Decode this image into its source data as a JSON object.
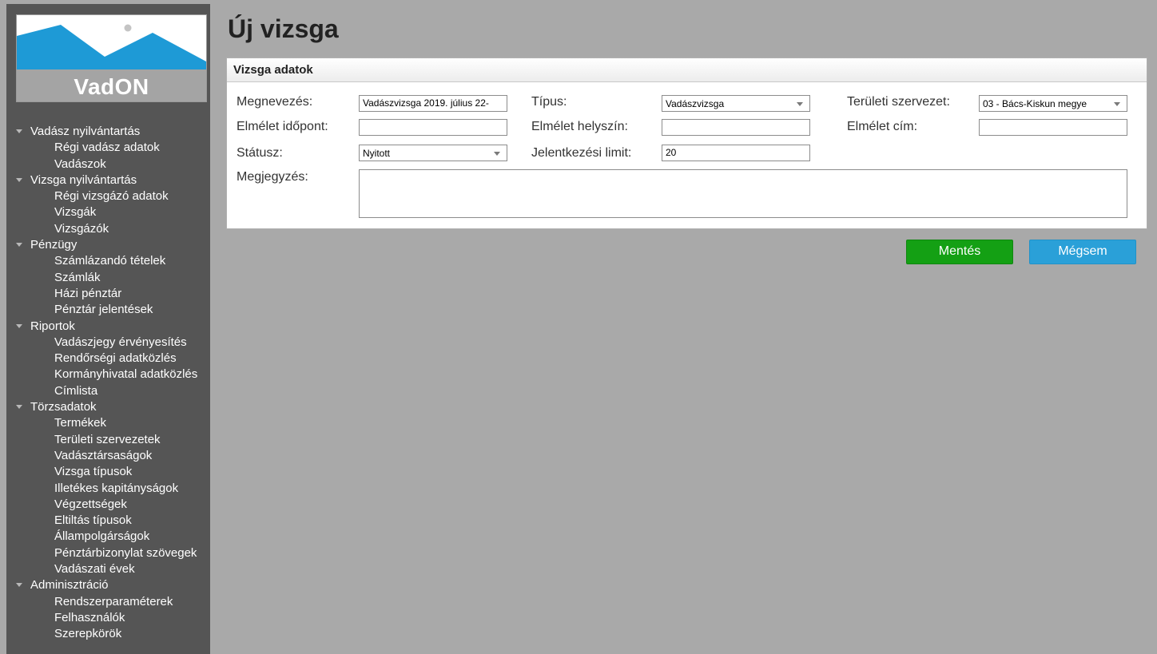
{
  "app": {
    "logo_text": "VadON"
  },
  "colors": {
    "sidebar_bg": "#555555",
    "page_bg": "#a9a9a9",
    "logo_blue": "#1e9ad6",
    "save_green": "#14a014",
    "cancel_blue": "#2aa0d8"
  },
  "nav": [
    {
      "label": "Vadász nyilvántartás",
      "items": [
        "Régi vadász adatok",
        "Vadászok"
      ]
    },
    {
      "label": "Vizsga nyilvántartás",
      "items": [
        "Régi vizsgázó adatok",
        "Vizsgák",
        "Vizsgázók"
      ]
    },
    {
      "label": "Pénzügy",
      "items": [
        "Számlázandó tételek",
        "Számlák",
        "Házi pénztár",
        "Pénztár jelentések"
      ]
    },
    {
      "label": "Riportok",
      "items": [
        "Vadászjegy érvényesítés",
        "Rendőrségi adatközlés",
        "Kormányhivatal adatközlés",
        "Címlista"
      ]
    },
    {
      "label": "Törzsadatok",
      "items": [
        "Termékek",
        "Területi szervezetek",
        "Vadásztársaságok",
        "Vizsga típusok",
        "Illetékes kapitányságok",
        "Végzettségek",
        "Eltiltás típusok",
        "Állampolgárságok",
        "Pénztárbizonylat szövegek",
        "Vadászati évek"
      ]
    },
    {
      "label": "Adminisztráció",
      "items": [
        "Rendszerparaméterek",
        "Felhasználók",
        "Szerepkörök"
      ]
    }
  ],
  "page": {
    "title": "Új vizsga"
  },
  "panel": {
    "title": "Vizsga adatok",
    "labels": {
      "name": "Megnevezés:",
      "type": "Típus:",
      "org": "Területi szervezet:",
      "theory_time": "Elmélet időpont:",
      "theory_place": "Elmélet helyszín:",
      "theory_address": "Elmélet cím:",
      "status": "Státusz:",
      "limit": "Jelentkezési limit:",
      "note": "Megjegyzés:"
    },
    "values": {
      "name": "Vadászvizsga 2019. július 22-",
      "type": "Vadászvizsga",
      "org": "03 - Bács-Kiskun megye",
      "theory_time": "",
      "theory_place": "",
      "theory_address": "",
      "status": "Nyitott",
      "limit": "20",
      "note": ""
    }
  },
  "buttons": {
    "save": "Mentés",
    "cancel": "Mégsem"
  }
}
